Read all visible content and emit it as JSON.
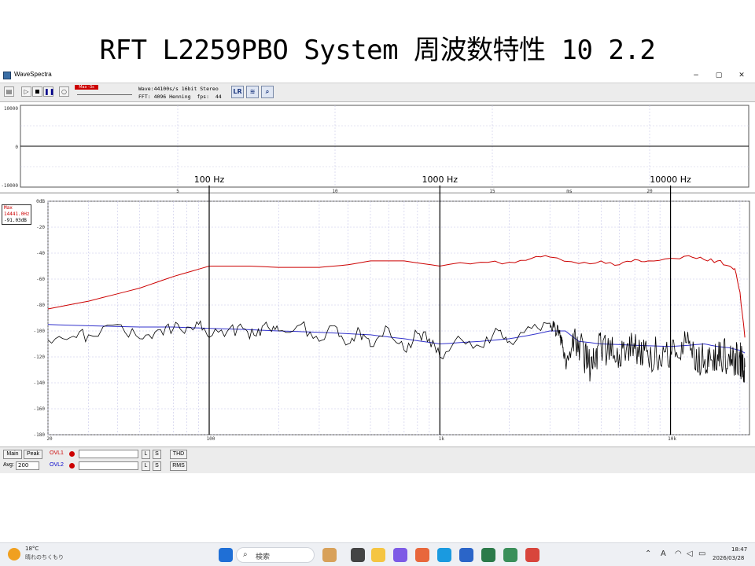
{
  "slide": {
    "title": "RFT L2259PBO System 周波数特性 10 2.2"
  },
  "window": {
    "title": "WaveSpectra",
    "controls": {
      "minimize": "−",
      "maximize": "▢",
      "close": "✕"
    }
  },
  "toolbar": {
    "wave_info": "Wave:44100s/s 16bit Stereo",
    "fft_info": "FFT: 4096 Henning  fps:  44",
    "level_indicator": "Max -3s"
  },
  "wave_panel": {
    "y_ticks": [
      "10000",
      "0",
      "-10000"
    ],
    "x_ticks": [
      "5",
      "10",
      "15",
      "20"
    ],
    "x_unit": "ms"
  },
  "spectrum": {
    "max_label": "Max",
    "max_freq": "14441.0Hz",
    "max_level": "-91.03dB",
    "y_ticks": [
      "0dB",
      "-20",
      "-40",
      "-60",
      "-80",
      "-100",
      "-120",
      "-140",
      "-160",
      "-180"
    ],
    "x_ticks": [
      "20",
      "100",
      "1k",
      "10k"
    ],
    "markers": [
      "100 Hz",
      "1000 Hz",
      "10000 Hz"
    ]
  },
  "controls": {
    "main": "Main",
    "peak": "Peak",
    "avg": "Avg:",
    "avg_value": "200",
    "ovl1": "OVL1",
    "ovl2": "OVL2",
    "l": "L",
    "s": "S",
    "thd": "THD",
    "rms": "RMS"
  },
  "taskbar": {
    "temperature": "18°C",
    "weather": "晴れのちくもり",
    "search_placeholder": "検索",
    "time": "18:47",
    "date": "2026/03/28",
    "ime": "A"
  },
  "chart_data": {
    "type": "line",
    "xscale": "log",
    "xlim": [
      20,
      22000
    ],
    "ylim": [
      -180,
      0
    ],
    "xlabel": "",
    "ylabel": "",
    "x_ticks": [
      "20",
      "100",
      "1k",
      "10k"
    ],
    "y_ticks": [
      "0dB",
      "-20",
      "-40",
      "-60",
      "-80",
      "-100",
      "-120",
      "-140",
      "-160",
      "-180"
    ],
    "grid": true,
    "annotations": [
      "100 Hz",
      "1000 Hz",
      "10000 Hz"
    ],
    "series": [
      {
        "color": "#cc0000",
        "x": [
          20,
          30,
          50,
          70,
          100,
          150,
          200,
          300,
          400,
          500,
          700,
          1000,
          1500,
          2000,
          2500,
          3000,
          4000,
          5000,
          6000,
          7000,
          8000,
          10000,
          12000,
          14000,
          16000,
          18000,
          19000,
          20000,
          21000
        ],
        "y": [
          -83,
          -77,
          -67,
          -58,
          -50,
          -50,
          -51,
          -51,
          -49,
          -46,
          -46,
          -50,
          -47,
          -47,
          -44,
          -43,
          -48,
          -46,
          -49,
          -45,
          -46,
          -44,
          -42,
          -45,
          -46,
          -50,
          -52,
          -70,
          -105
        ]
      },
      {
        "color": "#3333cc",
        "x": [
          20,
          30,
          50,
          70,
          100,
          150,
          200,
          300,
          500,
          700,
          1000,
          1500,
          2000,
          2500,
          3000,
          3500,
          4000,
          5000,
          7000,
          10000,
          12000,
          14000,
          16000,
          18000,
          20000,
          21000
        ],
        "y": [
          -95,
          -96,
          -97,
          -97,
          -98,
          -99,
          -100,
          -101,
          -103,
          -106,
          -110,
          -108,
          -106,
          -103,
          -100,
          -100,
          -108,
          -110,
          -111,
          -112,
          -111,
          -110,
          -112,
          -113,
          -115,
          -117
        ]
      },
      {
        "color": "#000000",
        "x": [
          20,
          25,
          30,
          40,
          50,
          60,
          70,
          80,
          90,
          100,
          120,
          140,
          160,
          180,
          200,
          250,
          300,
          350,
          400,
          450,
          500,
          600,
          700,
          800,
          900,
          1000,
          1200,
          1500,
          1800,
          2000,
          2500,
          3000,
          3300,
          3500,
          4000,
          4500,
          5000,
          6000,
          7000,
          8000,
          10000,
          12000,
          14000,
          16000,
          18000,
          20000,
          21000
        ],
        "y": [
          -107,
          -105,
          -103,
          -95,
          -106,
          -99,
          -98,
          -97,
          -95,
          -105,
          -100,
          -98,
          -104,
          -97,
          -100,
          -95,
          -108,
          -96,
          -110,
          -100,
          -112,
          -98,
          -115,
          -102,
          -106,
          -120,
          -104,
          -112,
          -100,
          -108,
          -98,
          -94,
          -102,
          -122,
          -108,
          -130,
          -112,
          -118,
          -114,
          -120,
          -115,
          -110,
          -125,
          -118,
          -120,
          -122,
          -128
        ]
      }
    ]
  }
}
